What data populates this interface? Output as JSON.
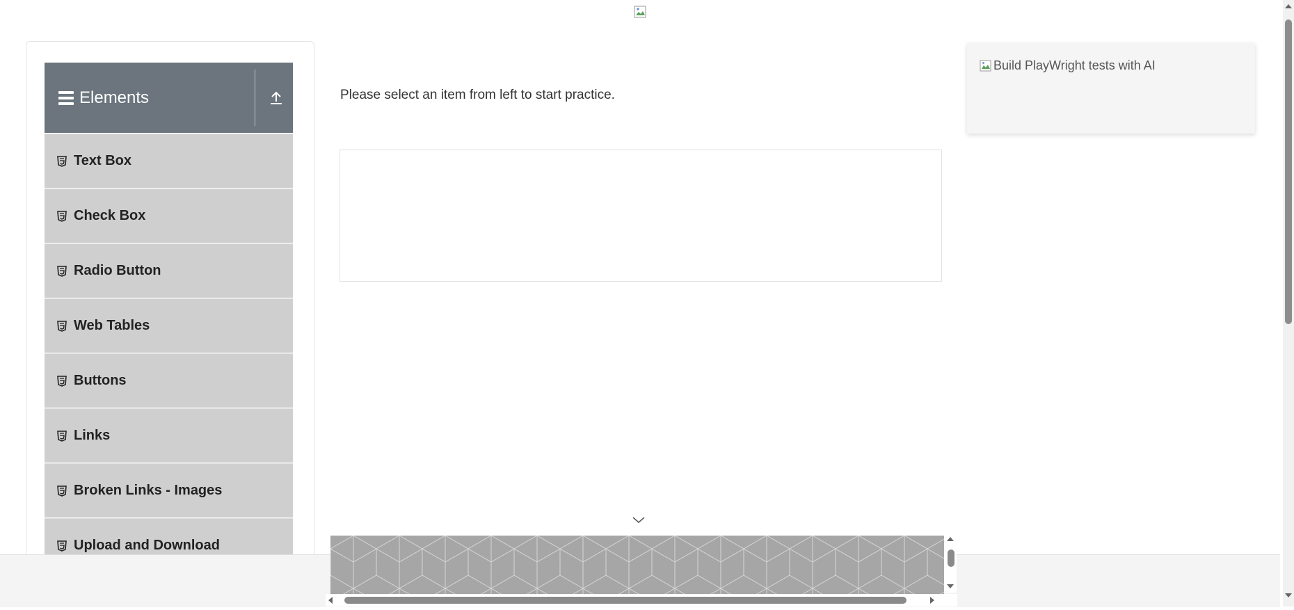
{
  "header": {
    "logo_icon": "broken-image-icon"
  },
  "sidebar": {
    "group_title": "Elements",
    "items": [
      {
        "label": "Text Box"
      },
      {
        "label": "Check Box"
      },
      {
        "label": "Radio Button"
      },
      {
        "label": "Web Tables"
      },
      {
        "label": "Buttons"
      },
      {
        "label": "Links"
      },
      {
        "label": "Broken Links - Images"
      },
      {
        "label": "Upload and Download"
      }
    ]
  },
  "main": {
    "prompt": "Please select an item from left to start practice."
  },
  "ad": {
    "alt_text": "Build PlayWright tests with AI"
  },
  "colors": {
    "group_header": "#6c757d",
    "menu_item": "#cfcfcf"
  }
}
